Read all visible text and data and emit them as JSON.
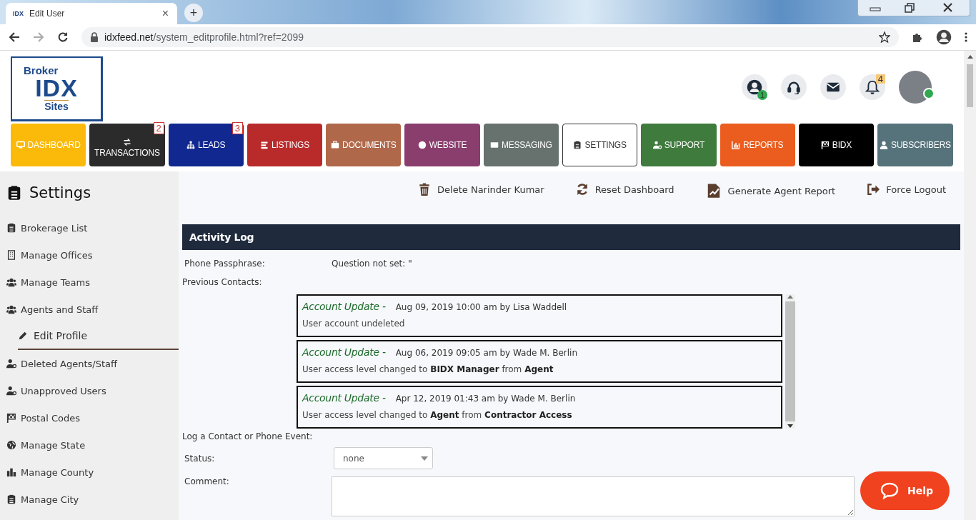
{
  "browser": {
    "tab": {
      "favicon": "IDX",
      "title": "Edit User",
      "close": "×"
    },
    "new_tab": "+",
    "url_host": "idxfeed.net",
    "url_path": "/system_editprofile.html?ref=2099"
  },
  "header": {
    "logo": {
      "top": "Broker",
      "main": "IDX",
      "bottom": "Sites"
    },
    "badges": {
      "account": "1",
      "notifications": "4"
    },
    "avatar": {
      "online": true
    }
  },
  "nav": [
    {
      "label": "DASHBOARD",
      "color": "#fbb909",
      "selected": false
    },
    {
      "label": "TRANSACTIONS",
      "color": "#2b2b2b",
      "selected": false,
      "badge": "2"
    },
    {
      "label": "LEADS",
      "color": "#10288f",
      "selected": false,
      "badge": "3"
    },
    {
      "label": "LISTINGS",
      "color": "#b92b2b",
      "selected": false
    },
    {
      "label": "DOCUMENTS",
      "color": "#b0684a",
      "selected": false
    },
    {
      "label": "WEBSITE",
      "color": "#8a3e6e",
      "selected": false
    },
    {
      "label": "MESSAGING",
      "color": "#67726f",
      "selected": false
    },
    {
      "label": "SETTINGS",
      "color": "#ffffff",
      "selected": true
    },
    {
      "label": "SUPPORT",
      "color": "#3f7b3d",
      "selected": false
    },
    {
      "label": "REPORTS",
      "color": "#ea5d1e",
      "selected": false
    },
    {
      "label": "BIDX",
      "color": "#000000",
      "selected": false
    },
    {
      "label": "SUBSCRIBERS",
      "color": "#56737b",
      "selected": false
    }
  ],
  "sidebar": {
    "title": "Settings",
    "items": [
      {
        "label": "Brokerage List",
        "selected": false
      },
      {
        "label": "Manage Offices",
        "selected": false
      },
      {
        "label": "Manage Teams",
        "selected": false
      },
      {
        "label": "Agents and Staff",
        "selected": false,
        "children": [
          {
            "label": "Edit Profile",
            "selected": true
          }
        ]
      },
      {
        "label": "Deleted Agents/Staff",
        "selected": false
      },
      {
        "label": "Unapproved Users",
        "selected": false
      },
      {
        "label": "Postal Codes",
        "selected": false
      },
      {
        "label": "Manage State",
        "selected": false
      },
      {
        "label": "Manage County",
        "selected": false
      },
      {
        "label": "Manage City",
        "selected": false
      }
    ]
  },
  "actions": [
    "Delete Narinder Kumar",
    "Reset Dashboard",
    "Generate Agent Report",
    "Force Logout"
  ],
  "activity_log": {
    "title": "Activity Log",
    "passphrase_label": "Phone Passphrase:",
    "passphrase_value": "Question not set: \"",
    "contacts_label": "Previous Contacts:",
    "entries": [
      {
        "type": "Account Update -",
        "meta": "Aug 09, 2019 10:00 am by Lisa Waddell",
        "text": "User account undeleted"
      },
      {
        "type": "Account Update -",
        "meta": "Aug 06, 2019 09:05 am by Wade M. Berlin",
        "text": "User access level changed to **BIDX Manager** from **Agent**"
      },
      {
        "type": "Account Update -",
        "meta": "Apr 12, 2019 01:43 am by Wade M. Berlin",
        "text": "User access level changed to **Agent** from **Contractor Access**"
      }
    ]
  },
  "log_event": {
    "title": "Log a Contact or Phone Event:",
    "status_label": "Status:",
    "status_value": "none",
    "comment_label": "Comment:"
  },
  "help": "Help"
}
